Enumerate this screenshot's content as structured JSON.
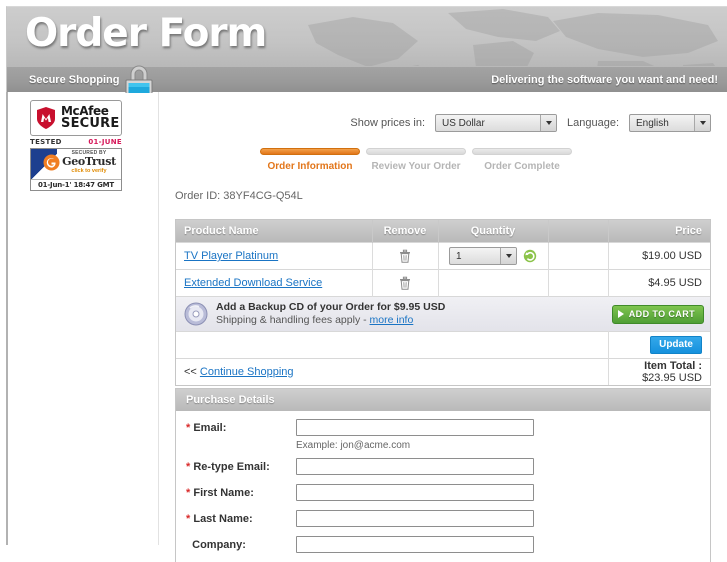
{
  "header": {
    "title": "Order Form",
    "secure_tab": "Secure Shopping",
    "tagline": "Delivering the software you want and need!",
    "padlock_icon": "padlock-icon"
  },
  "badges": {
    "mcafee": {
      "line1": "McAfee",
      "line2": "SECURE",
      "tested_label": "TESTED",
      "tested_date": "01-JUNE",
      "shield_icon": "mcafee-shield-icon"
    },
    "geotrust": {
      "secured_by": "SECURED BY",
      "name": "GeoTrust",
      "verify": "click to verify",
      "stamp": "01-Jun-1' 18:47 GMT",
      "swirl_icon": "geotrust-swirl-icon"
    }
  },
  "toolbar": {
    "currency_label": "Show prices in:",
    "currency_value": "US Dollar",
    "language_label": "Language:",
    "language_value": "English",
    "dropdown_icon": "chevron-down-icon"
  },
  "steps": [
    {
      "label": "Order Information",
      "active": true
    },
    {
      "label": "Review Your Order",
      "active": false
    },
    {
      "label": "Order Complete",
      "active": false
    }
  ],
  "order": {
    "order_id_text": "Order ID: 38YF4CG-Q54L"
  },
  "cart": {
    "columns": {
      "product": "Product Name",
      "remove": "Remove",
      "quantity": "Quantity",
      "price": "Price"
    },
    "rows": [
      {
        "product": "TV Player Platinum",
        "quantity": "1",
        "price": "$19.00 USD",
        "has_quantity": true
      },
      {
        "product": "Extended Download Service",
        "quantity": "",
        "price": "$4.95 USD",
        "has_quantity": false
      }
    ],
    "backup_cd": {
      "line1": "Add a Backup CD of your Order for $9.95 USD",
      "line2_prefix": "Shipping & handling fees apply - ",
      "more_info": "more info",
      "button": "ADD TO CART",
      "cd_icon": "compact-disc-icon"
    },
    "update_button": "Update",
    "continue_prefix": "<<",
    "continue_shopping": "Continue Shopping",
    "item_total_label": "Item Total :",
    "item_total_value": "$23.95 USD",
    "trash_icon": "trash-icon",
    "refresh_icon": "refresh-icon"
  },
  "details": {
    "heading": "Purchase Details",
    "fields": [
      {
        "label": "Email:",
        "required": true,
        "value": "",
        "hint": "Example: jon@acme.com"
      },
      {
        "label": "Re-type Email:",
        "required": true,
        "value": "",
        "hint": ""
      },
      {
        "label": "First Name:",
        "required": true,
        "value": "",
        "hint": ""
      },
      {
        "label": "Last Name:",
        "required": true,
        "value": "",
        "hint": ""
      },
      {
        "label": "Company:",
        "required": false,
        "value": "",
        "hint": ""
      }
    ]
  },
  "colors": {
    "accent_orange": "#e2761a",
    "link_blue": "#1a74c4",
    "button_blue": "#1591dd",
    "button_green": "#4f9e35",
    "required_red": "#d92b2b",
    "header_gray": "#b5b5b5"
  }
}
